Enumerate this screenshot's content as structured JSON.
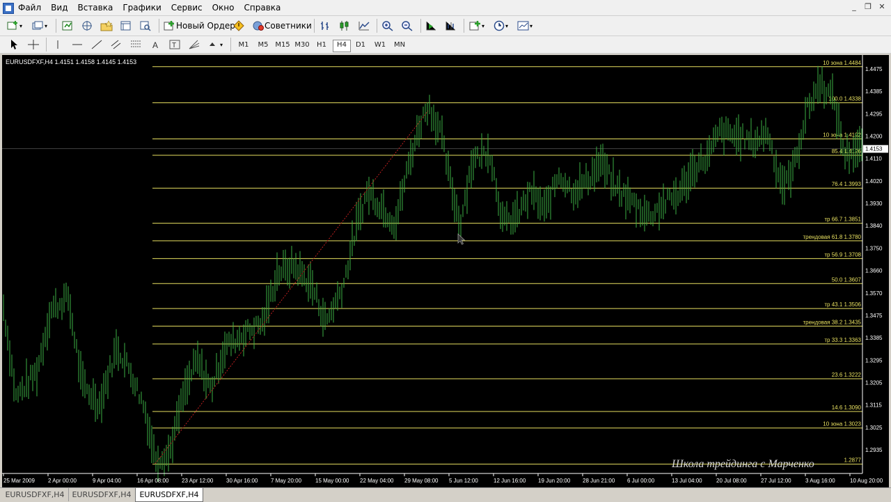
{
  "menu": {
    "items": [
      "Файл",
      "Вид",
      "Вставка",
      "Графики",
      "Сервис",
      "Окно",
      "Справка"
    ]
  },
  "toolbar": {
    "new_order_label": "Новый Ордер",
    "experts_label": "Советники",
    "timeframes": [
      "M1",
      "M5",
      "M15",
      "M30",
      "H1",
      "H4",
      "D1",
      "W1",
      "MN"
    ],
    "active_timeframe": "H4"
  },
  "chart": {
    "title": "EURUSDFXF,H4  1.4151 1.4158 1.4145 1.4153",
    "current_price": "1.4153",
    "price_ticks": [
      "1.4475",
      "1.4385",
      "1.4295",
      "1.4200",
      "1.4110",
      "1.4020",
      "1.3930",
      "1.3840",
      "1.3750",
      "1.3660",
      "1.3570",
      "1.3475",
      "1.3385",
      "1.3295",
      "1.3205",
      "1.3115",
      "1.3025",
      "1.2935"
    ],
    "time_ticks": [
      "25 Mar 2009",
      "2 Apr 00:00",
      "9 Apr 04:00",
      "16 Apr 08:00",
      "23 Apr 12:00",
      "30 Apr 16:00",
      "7 May 20:00",
      "15 May 00:00",
      "22 May 04:00",
      "29 May 08:00",
      "5 Jun 12:00",
      "12 Jun 16:00",
      "19 Jun 20:00",
      "28 Jun 21:00",
      "6 Jul 00:00",
      "13 Jul 04:00",
      "20 Jul 08:00",
      "27 Jul 12:00",
      "3 Aug 16:00",
      "10 Aug 20:00"
    ],
    "levels": [
      {
        "name": "10 зона",
        "value": "1.4484",
        "price": 1.4484
      },
      {
        "name": "100.0",
        "value": "1.4338",
        "price": 1.4338
      },
      {
        "name": "10 зона",
        "value": "1.4192",
        "price": 1.4192
      },
      {
        "name": "85.4",
        "value": "1.4126",
        "price": 1.4126
      },
      {
        "name": "76.4",
        "value": "1.3993",
        "price": 1.3993
      },
      {
        "name": "тр 66.7",
        "value": "1.3851",
        "price": 1.3851
      },
      {
        "name": "трендовая 61.8",
        "value": "1.3780",
        "price": 1.378
      },
      {
        "name": "тр 56.9",
        "value": "1.3708",
        "price": 1.3708
      },
      {
        "name": "50.0",
        "value": "1.3607",
        "price": 1.3607
      },
      {
        "name": "тр 43.1",
        "value": "1.3506",
        "price": 1.3506
      },
      {
        "name": "трендовая 38.2",
        "value": "1.3435",
        "price": 1.3435
      },
      {
        "name": "тр 33.3",
        "value": "1.3363",
        "price": 1.3363
      },
      {
        "name": "23.6",
        "value": "1.3222",
        "price": 1.3222
      },
      {
        "name": "14.6",
        "value": "1.3090",
        "price": 1.309
      },
      {
        "name": "10 зона",
        "value": "1.3023",
        "price": 1.3023
      },
      {
        "name": "",
        "value": "1.2877",
        "price": 1.2877
      }
    ],
    "watermark": "Школа трейдинга с Марченко",
    "colors": {
      "background": "#000000",
      "bars": "#3cb043",
      "levels": "#e8e060",
      "trendline": "#c02020",
      "text": "#ffffff"
    }
  },
  "tabs": [
    "EURUSDFXF,H4",
    "EURUSDFXF,H4",
    "EURUSDFXF,H4"
  ],
  "active_tab_index": 2
}
